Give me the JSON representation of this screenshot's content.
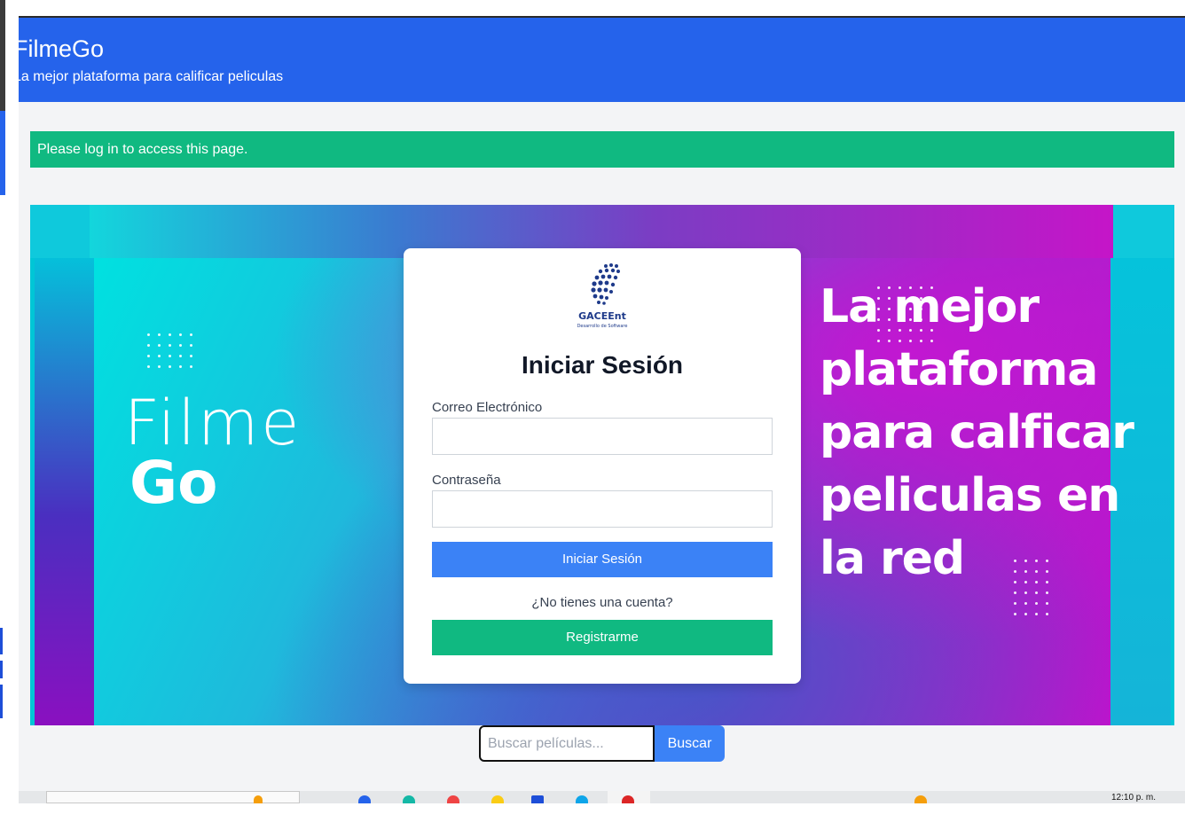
{
  "navbar": {
    "brand": "FilmeGo",
    "tagline": "La mejor plataforma para calificar peliculas"
  },
  "alert": {
    "message": "Please log in to access this page."
  },
  "hero": {
    "logo_line1": "Filme",
    "logo_line2": "Go",
    "headline_lines": [
      "La mejor",
      "plataforma",
      "para calficar",
      "peliculas en",
      "la red"
    ]
  },
  "login": {
    "company_logo": "GACEEnt",
    "company_sub": "Desarrollo de Software",
    "title": "Iniciar Sesión",
    "email_label": "Correo Electrónico",
    "email_value": "",
    "password_label": "Contraseña",
    "password_value": "",
    "login_button": "Iniciar Sesión",
    "no_account_text": "¿No tienes una cuenta?",
    "register_button": "Registrarme"
  },
  "search": {
    "placeholder": "Buscar películas...",
    "button": "Buscar"
  },
  "taskbar": {
    "time": "12:10 p. m."
  },
  "colors": {
    "primary_blue": "#2563eb",
    "button_blue": "#3b82f6",
    "success_green": "#10b981",
    "page_background": "#f3f4f6"
  }
}
